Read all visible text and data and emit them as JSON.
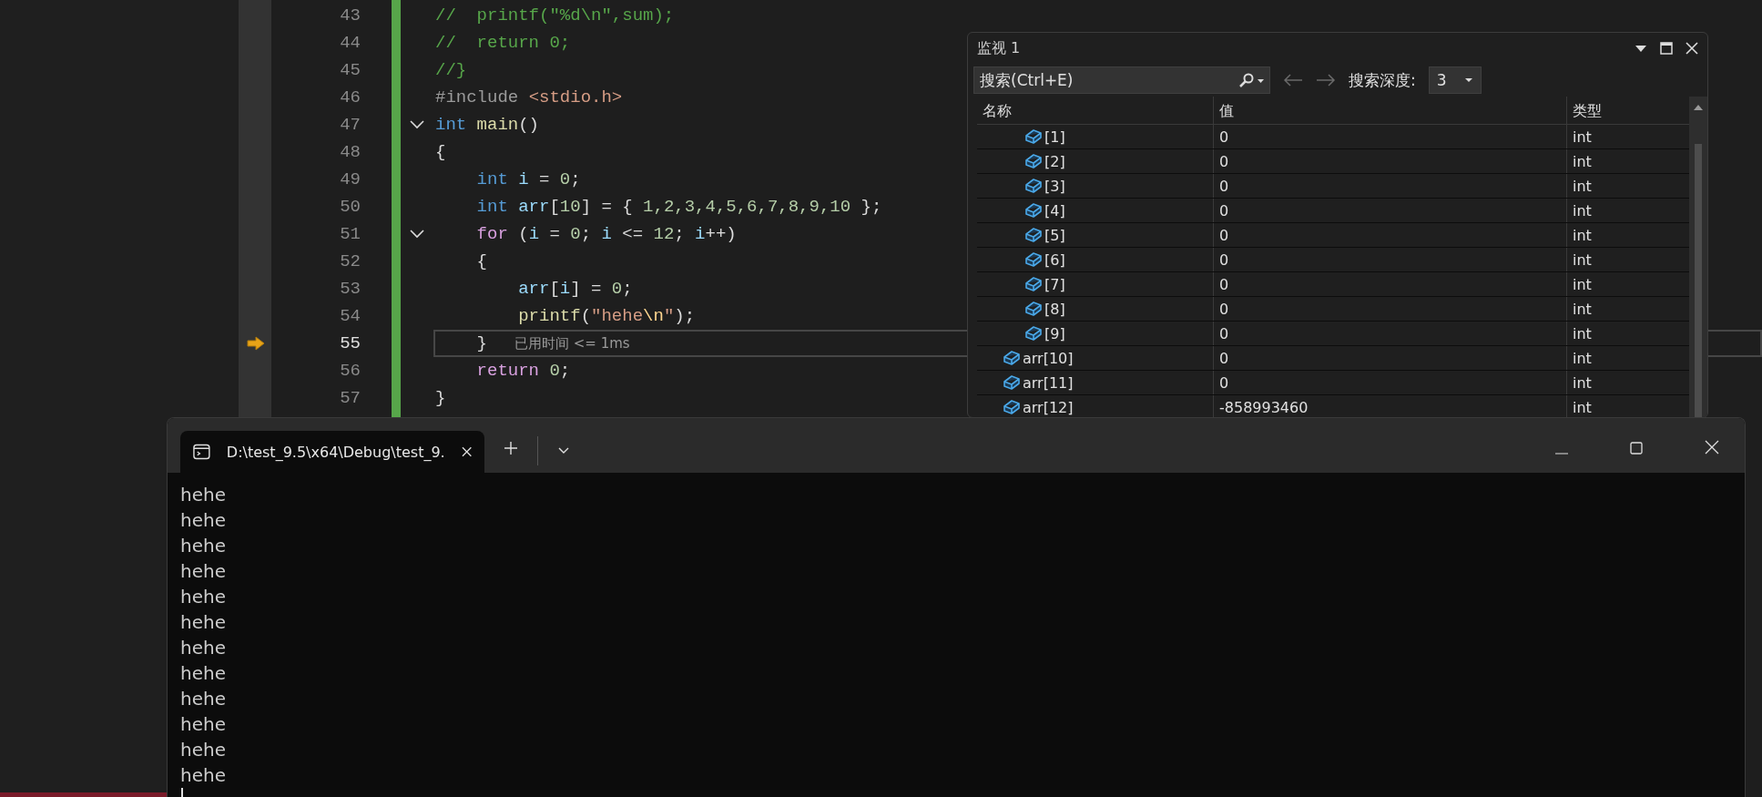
{
  "editor": {
    "lines": [
      {
        "number": "43",
        "fold": false,
        "current": false,
        "tokens": [
          {
            "text": "//  printf(\"%d\\n\",sum);",
            "kind": "comment"
          }
        ]
      },
      {
        "number": "44",
        "fold": false,
        "current": false,
        "tokens": [
          {
            "text": "//  return 0;",
            "kind": "comment"
          }
        ]
      },
      {
        "number": "45",
        "fold": false,
        "current": false,
        "tokens": [
          {
            "text": "//}",
            "kind": "comment"
          }
        ]
      },
      {
        "number": "46",
        "fold": false,
        "current": false,
        "tokens": [
          {
            "text": "#include ",
            "kind": "preproc"
          },
          {
            "text": "<stdio.h>",
            "kind": "string"
          }
        ]
      },
      {
        "number": "47",
        "fold": true,
        "current": false,
        "tokens": [
          {
            "text": "int ",
            "kind": "keyword"
          },
          {
            "text": "main",
            "kind": "func"
          },
          {
            "text": "()",
            "kind": "plain"
          }
        ]
      },
      {
        "number": "48",
        "fold": false,
        "current": false,
        "tokens": [
          {
            "text": "{",
            "kind": "plain"
          }
        ]
      },
      {
        "number": "49",
        "fold": false,
        "current": false,
        "tokens": [
          {
            "text": "    int ",
            "kind": "keyword"
          },
          {
            "text": "i",
            "kind": "var"
          },
          {
            "text": " = ",
            "kind": "plain"
          },
          {
            "text": "0",
            "kind": "number"
          },
          {
            "text": ";",
            "kind": "plain"
          }
        ]
      },
      {
        "number": "50",
        "fold": false,
        "current": false,
        "tokens": [
          {
            "text": "    int ",
            "kind": "keyword"
          },
          {
            "text": "arr",
            "kind": "var"
          },
          {
            "text": "[",
            "kind": "plain"
          },
          {
            "text": "10",
            "kind": "number"
          },
          {
            "text": "] = { ",
            "kind": "plain"
          },
          {
            "text": "1,2,3,4,5,6,7,8,9,10",
            "kind": "number"
          },
          {
            "text": " };",
            "kind": "plain"
          }
        ]
      },
      {
        "number": "51",
        "fold": true,
        "current": false,
        "tokens": [
          {
            "text": "    for ",
            "kind": "control"
          },
          {
            "text": "(",
            "kind": "plain"
          },
          {
            "text": "i",
            "kind": "var"
          },
          {
            "text": " = ",
            "kind": "plain"
          },
          {
            "text": "0",
            "kind": "number"
          },
          {
            "text": "; ",
            "kind": "plain"
          },
          {
            "text": "i",
            "kind": "var"
          },
          {
            "text": " <= ",
            "kind": "plain"
          },
          {
            "text": "12",
            "kind": "number"
          },
          {
            "text": "; ",
            "kind": "plain"
          },
          {
            "text": "i",
            "kind": "var"
          },
          {
            "text": "++)",
            "kind": "plain"
          }
        ]
      },
      {
        "number": "52",
        "fold": false,
        "current": false,
        "tokens": [
          {
            "text": "    {",
            "kind": "plain"
          }
        ]
      },
      {
        "number": "53",
        "fold": false,
        "current": false,
        "tokens": [
          {
            "text": "        arr",
            "kind": "var"
          },
          {
            "text": "[",
            "kind": "plain"
          },
          {
            "text": "i",
            "kind": "var"
          },
          {
            "text": "] = ",
            "kind": "plain"
          },
          {
            "text": "0",
            "kind": "number"
          },
          {
            "text": ";",
            "kind": "plain"
          }
        ]
      },
      {
        "number": "54",
        "fold": false,
        "current": false,
        "tokens": [
          {
            "text": "        printf",
            "kind": "func"
          },
          {
            "text": "(",
            "kind": "plain"
          },
          {
            "text": "\"hehe",
            "kind": "string"
          },
          {
            "text": "\\n",
            "kind": "escape"
          },
          {
            "text": "\"",
            "kind": "string"
          },
          {
            "text": ");",
            "kind": "plain"
          }
        ]
      },
      {
        "number": "55",
        "fold": false,
        "current": true,
        "hint": "已用时间 <= 1ms",
        "tokens": [
          {
            "text": "    }",
            "kind": "plain"
          }
        ]
      },
      {
        "number": "56",
        "fold": false,
        "current": false,
        "tokens": [
          {
            "text": "    return ",
            "kind": "control"
          },
          {
            "text": "0",
            "kind": "number"
          },
          {
            "text": ";",
            "kind": "plain"
          }
        ]
      },
      {
        "number": "57",
        "fold": false,
        "current": false,
        "tokens": [
          {
            "text": "}",
            "kind": "plain"
          }
        ]
      }
    ]
  },
  "watch": {
    "title": "监视 1",
    "search": {
      "placeholder": "搜索(Ctrl+E)"
    },
    "depth_label": "搜索深度:",
    "depth": "3",
    "columns": [
      "名称",
      "值",
      "类型"
    ],
    "rows": [
      {
        "children": [
          {
            "name": "[1]",
            "value": "0",
            "type": "int"
          },
          {
            "name": "[2]",
            "value": "0",
            "type": "int"
          },
          {
            "name": "[3]",
            "value": "0",
            "type": "int"
          },
          {
            "name": "[4]",
            "value": "0",
            "type": "int"
          },
          {
            "name": "[5]",
            "value": "0",
            "type": "int"
          },
          {
            "name": "[6]",
            "value": "0",
            "type": "int"
          },
          {
            "name": "[7]",
            "value": "0",
            "type": "int"
          },
          {
            "name": "[8]",
            "value": "0",
            "type": "int"
          },
          {
            "name": "[9]",
            "value": "0",
            "type": "int"
          }
        ]
      },
      {
        "name": "arr[10]",
        "value": "0",
        "type": "int"
      },
      {
        "name": "arr[11]",
        "value": "0",
        "type": "int"
      },
      {
        "name": "arr[12]",
        "value": "-858993460",
        "type": "int"
      }
    ]
  },
  "terminal": {
    "tab_title": "D:\\test_9.5\\x64\\Debug\\test_9.",
    "output": [
      "hehe",
      "hehe",
      "hehe",
      "hehe",
      "hehe",
      "hehe",
      "hehe",
      "hehe",
      "hehe",
      "hehe",
      "hehe",
      "hehe"
    ]
  }
}
